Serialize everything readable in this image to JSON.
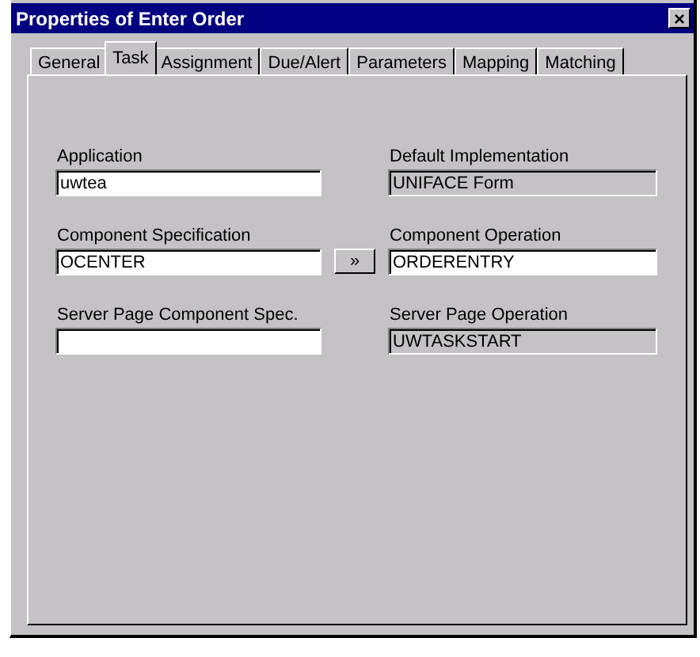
{
  "window": {
    "title": "Properties of Enter Order",
    "close": "×"
  },
  "tabs": [
    {
      "label": "General",
      "selected": false
    },
    {
      "label": "Task",
      "selected": true
    },
    {
      "label": "Assignment",
      "selected": false
    },
    {
      "label": "Due/Alert",
      "selected": false
    },
    {
      "label": "Parameters",
      "selected": false
    },
    {
      "label": "Mapping",
      "selected": false
    },
    {
      "label": "Matching",
      "selected": false
    }
  ],
  "rows": [
    {
      "left": {
        "label": "Application",
        "value": "uwtea",
        "disabled": false
      },
      "right": {
        "label": "Default Implementation",
        "value": "UNIFACE Form",
        "disabled": true
      }
    },
    {
      "left": {
        "label": "Component Specification",
        "value": "OCENTER",
        "disabled": false
      },
      "button": "»",
      "right": {
        "label": "Component Operation",
        "value": "ORDERENTRY",
        "disabled": false
      }
    },
    {
      "left": {
        "label": "Server Page Component Spec.",
        "disabled": false
      },
      "right": {
        "label": "Server Page Operation",
        "value": "UWTASKSTART",
        "disabled": true
      }
    }
  ]
}
